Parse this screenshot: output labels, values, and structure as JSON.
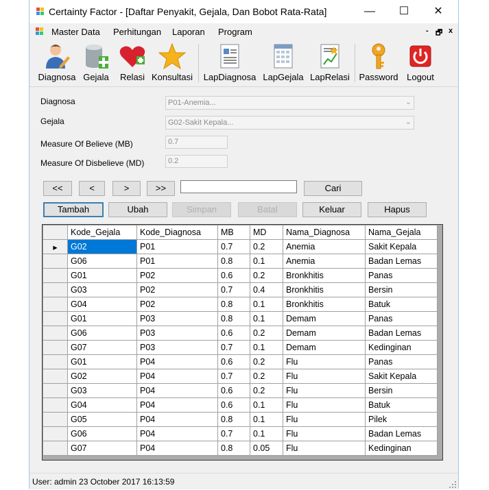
{
  "window": {
    "title": "Certainty Factor - [Daftar Penyakit, Gejala, Dan Bobot Rata-Rata]",
    "minimize": "—",
    "maximize": "☐",
    "close": "✕"
  },
  "menu": {
    "items": [
      "Master Data",
      "Perhitungan",
      "Laporan",
      "Program"
    ],
    "mdi": {
      "minimize": "-",
      "restore": "🗗",
      "close": "x"
    }
  },
  "toolbar": [
    {
      "label": "Diagnosa",
      "icon": "user-edit-icon"
    },
    {
      "label": "Gejala",
      "icon": "database-add-icon"
    },
    {
      "label": "Relasi",
      "icon": "heart-add-icon"
    },
    {
      "label": "Konsultasi",
      "icon": "star-icon"
    },
    {
      "label": "LapDiagnosa",
      "icon": "report-icon"
    },
    {
      "label": "LapGejala",
      "icon": "report-calendar-icon"
    },
    {
      "label": "LapRelasi",
      "icon": "report-chart-icon"
    },
    {
      "label": "Password",
      "icon": "key-icon"
    },
    {
      "label": "Logout",
      "icon": "power-icon"
    }
  ],
  "form": {
    "diagnosa_label": "Diagnosa",
    "diagnosa_value": "P01-Anemia...",
    "gejala_label": "Gejala",
    "gejala_value": "G02-Sakit Kepala...",
    "mb_label": "Measure Of Believe (MB)",
    "mb_value": "0.7",
    "md_label": "Measure Of Disbelieve (MD)",
    "md_value": "0.2"
  },
  "nav": {
    "first": "<<",
    "prev": "<",
    "next": ">",
    "last": ">>",
    "search_value": "",
    "cari": "Cari"
  },
  "actions": {
    "tambah": "Tambah",
    "ubah": "Ubah",
    "simpan": "Simpan",
    "batal": "Batal",
    "keluar": "Keluar",
    "hapus": "Hapus"
  },
  "grid": {
    "columns": [
      "Kode_Gejala",
      "Kode_Diagnosa",
      "MB",
      "MD",
      "Nama_Diagnosa",
      "Nama_Gejala"
    ],
    "current_row_marker": "▸",
    "rows": [
      [
        "G02",
        "P01",
        "0.7",
        "0.2",
        "Anemia",
        "Sakit Kepala"
      ],
      [
        "G06",
        "P01",
        "0.8",
        "0.1",
        "Anemia",
        "Badan Lemas"
      ],
      [
        "G01",
        "P02",
        "0.6",
        "0.2",
        "Bronkhitis",
        "Panas"
      ],
      [
        "G03",
        "P02",
        "0.7",
        "0.4",
        "Bronkhitis",
        "Bersin"
      ],
      [
        "G04",
        "P02",
        "0.8",
        "0.1",
        "Bronkhitis",
        "Batuk"
      ],
      [
        "G01",
        "P03",
        "0.8",
        "0.1",
        "Demam",
        "Panas"
      ],
      [
        "G06",
        "P03",
        "0.6",
        "0.2",
        "Demam",
        "Badan Lemas"
      ],
      [
        "G07",
        "P03",
        "0.7",
        "0.1",
        "Demam",
        "Kedinginan"
      ],
      [
        "G01",
        "P04",
        "0.6",
        "0.2",
        "Flu",
        "Panas"
      ],
      [
        "G02",
        "P04",
        "0.7",
        "0.2",
        "Flu",
        "Sakit Kepala"
      ],
      [
        "G03",
        "P04",
        "0.6",
        "0.2",
        "Flu",
        "Bersin"
      ],
      [
        "G04",
        "P04",
        "0.6",
        "0.1",
        "Flu",
        "Batuk"
      ],
      [
        "G05",
        "P04",
        "0.8",
        "0.1",
        "Flu",
        "Pilek"
      ],
      [
        "G06",
        "P04",
        "0.7",
        "0.1",
        "Flu",
        "Badan Lemas"
      ],
      [
        "G07",
        "P04",
        "0.8",
        "0.05",
        "Flu",
        "Kedinginan"
      ]
    ]
  },
  "status": {
    "text": "User: admin  23 October 2017 16:13:59"
  },
  "colors": {
    "selection": "#0078d7",
    "window_bg": "#f0f0f0"
  }
}
